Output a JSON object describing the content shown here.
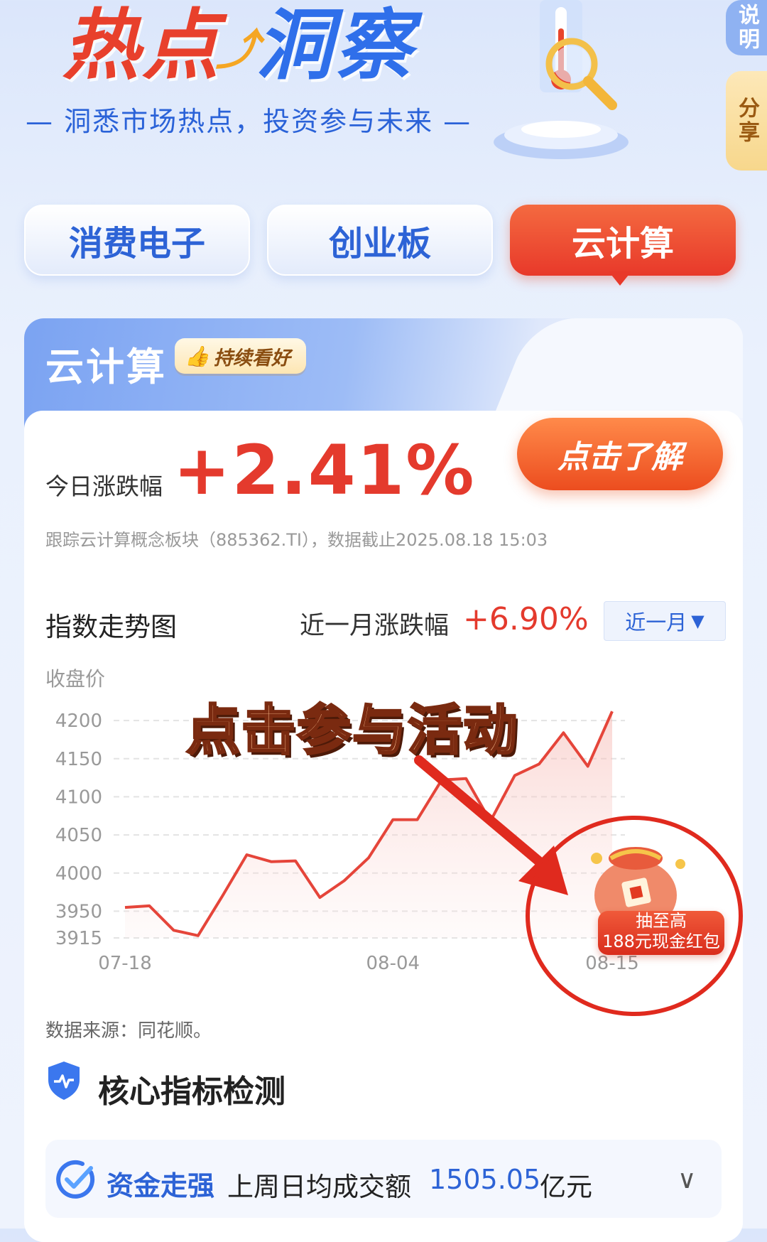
{
  "header": {
    "title_part1": "热点",
    "title_part2": "洞察",
    "subtitle": "— 洞悉市场热点，投资参与未来 —"
  },
  "side": {
    "explain": "说明",
    "share": "分享"
  },
  "tabs": [
    {
      "label": "消费电子",
      "active": false
    },
    {
      "label": "创业板",
      "active": false
    },
    {
      "label": "云计算",
      "active": true
    }
  ],
  "card": {
    "title": "云计算",
    "badge": "持续看好",
    "today_label": "今日涨跌幅",
    "today_value": "+2.41%",
    "learn_button": "点击了解",
    "track_note": "跟踪云计算概念板块（885362.TI），数据截止2025.08.18 15:03"
  },
  "trend": {
    "title": "指数走势图",
    "month_label": "近一月涨跌幅",
    "month_value": "+6.90%",
    "range_selected": "近一月",
    "source": "数据来源：同花顺。"
  },
  "chart_data": {
    "type": "area",
    "ylabel": "收盘价",
    "y_ticks": [
      3915,
      3950,
      4000,
      4050,
      4100,
      4150,
      4200
    ],
    "ylim": [
      3915,
      4215
    ],
    "x_tick_labels": [
      "07-18",
      "08-04",
      "08-15"
    ],
    "x_tick_index": [
      0,
      11,
      20
    ],
    "values": [
      3955,
      3957,
      3925,
      3918,
      3970,
      4024,
      4015,
      4016,
      3968,
      3990,
      4020,
      4070,
      4070,
      4122,
      4124,
      4068,
      4128,
      4143,
      4184,
      4140,
      4212
    ],
    "grid": true,
    "line_color": "#e5453a"
  },
  "overlay": {
    "promo_text": "点击参与活动",
    "bag_tag_line1": "抽至高",
    "bag_tag_line2": "188元现金红包"
  },
  "core": {
    "title": "核心指标检测",
    "metric_name": "资金走强",
    "metric_desc": "上周日均成交额",
    "metric_value": "1505.05",
    "metric_unit": "亿元"
  },
  "icons": {
    "thumb": "thumbs-up-icon",
    "shield": "shield-pulse-icon",
    "check": "check-circle-icon",
    "chevron": "chevron-down-icon",
    "triangle": "triangle-down-icon"
  }
}
